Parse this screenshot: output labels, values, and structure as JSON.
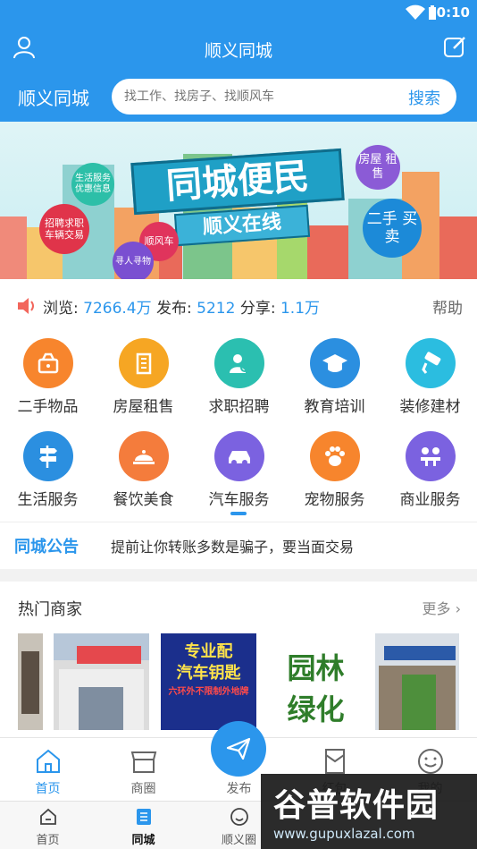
{
  "status_bar": {
    "time": "10:10"
  },
  "header": {
    "title": "顺义同城",
    "city": "顺义同城",
    "search_placeholder": "找工作、找房子、找顺风车",
    "search_button": "搜索"
  },
  "banner": {
    "main_title": "同城便民",
    "sub_title": "顺义在线",
    "tags": [
      "生活服务 优惠信息",
      "招聘求职 车辆交易",
      "顺风车",
      "寻人寻物",
      "房屋 租售",
      "二手 买卖"
    ]
  },
  "stats": {
    "views_label": "浏览:",
    "views_value": "7266.4万",
    "posts_label": "发布:",
    "posts_value": "5212",
    "shares_label": "分享:",
    "shares_value": "1.1万",
    "help": "帮助"
  },
  "categories": [
    {
      "label": "二手物品",
      "icon": "basket-icon",
      "color": "#f7852d"
    },
    {
      "label": "房屋租售",
      "icon": "building-icon",
      "color": "#f6a623"
    },
    {
      "label": "求职招聘",
      "icon": "job-search-icon",
      "color": "#2bbfb0"
    },
    {
      "label": "教育培训",
      "icon": "graduation-cap-icon",
      "color": "#2b8fe0"
    },
    {
      "label": "装修建材",
      "icon": "paint-roller-icon",
      "color": "#2bbde0"
    },
    {
      "label": "生活服务",
      "icon": "signpost-icon",
      "color": "#2b8fe0"
    },
    {
      "label": "餐饮美食",
      "icon": "food-cloche-icon",
      "color": "#f47c3c"
    },
    {
      "label": "汽车服务",
      "icon": "car-icon",
      "color": "#7b62e0"
    },
    {
      "label": "宠物服务",
      "icon": "paw-icon",
      "color": "#f7852d"
    },
    {
      "label": "商业服务",
      "icon": "business-meeting-icon",
      "color": "#7b62e0"
    }
  ],
  "notice": {
    "tag": "同城公告",
    "message": "提前让你转账多数是骗子，要当面交易"
  },
  "merchants": {
    "title": "热门商家",
    "more": "更多",
    "items": [
      {
        "text": ""
      },
      {
        "text": ""
      },
      {
        "line1": "专业配",
        "line2": "汽车钥匙",
        "line3": "六环外不限制外地牌"
      },
      {
        "line1": "园林",
        "line2": "绿化"
      },
      {
        "text": ""
      }
    ]
  },
  "bottom_nav": {
    "items": [
      {
        "label": "首页",
        "icon": "home-icon"
      },
      {
        "label": "商圈",
        "icon": "shop-icon"
      },
      {
        "label": "发布",
        "icon": "paper-plane-icon"
      },
      {
        "label": "红包",
        "icon": "red-envelope-icon"
      },
      {
        "label": "我的",
        "icon": "smile-icon"
      }
    ]
  },
  "system_nav": {
    "items": [
      {
        "label": "首页"
      },
      {
        "label": "同城"
      },
      {
        "label": "顺义圈"
      }
    ]
  },
  "watermark": {
    "title": "谷普软件园",
    "url": "www.gupuxlazal.com"
  }
}
